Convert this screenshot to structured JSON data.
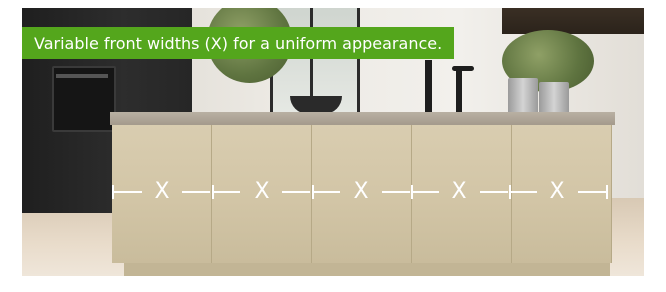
{
  "banner": {
    "text": "Variable front widths (X) for a uniform appearance.",
    "background_color": "#54a61c",
    "text_color": "#ffffff"
  },
  "dimension_labels": [
    "X",
    "X",
    "X",
    "X",
    "X"
  ],
  "photo": {
    "description_icon": "kitchen-photo"
  }
}
